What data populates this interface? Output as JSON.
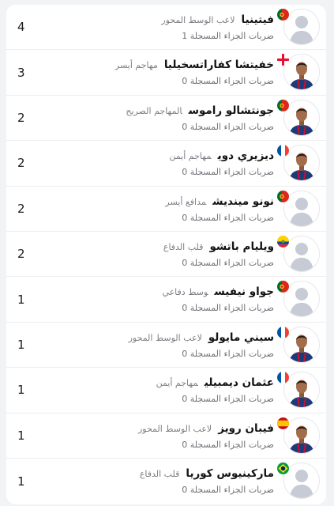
{
  "players": [
    {
      "name": "فيتينيا",
      "position": "لاعب الوسط المحور",
      "stat_label": "ضربات الجزاء المسجلة",
      "stat_value": "1",
      "count": "4",
      "flag": "portugal",
      "avatar": "placeholder"
    },
    {
      "name": "خفيتشا كفاراتسخيليا",
      "position": "مهاجم أيسر",
      "stat_label": "ضربات الجزاء المسجلة",
      "stat_value": "0",
      "count": "3",
      "flag": "georgia",
      "avatar": "photo"
    },
    {
      "name": "جونتشالو راموس",
      "position": "المهاجم الصريح",
      "stat_label": "ضربات الجزاء المسجلة",
      "stat_value": "0",
      "count": "2",
      "flag": "portugal",
      "avatar": "photo"
    },
    {
      "name": "ديزيري دوي",
      "position": "مهاجم أيمن",
      "stat_label": "ضربات الجزاء المسجلة",
      "stat_value": "0",
      "count": "2",
      "flag": "france",
      "avatar": "photo"
    },
    {
      "name": "نونو مينديش",
      "position": "مدافع أيسر",
      "stat_label": "ضربات الجزاء المسجلة",
      "stat_value": "0",
      "count": "2",
      "flag": "portugal",
      "avatar": "placeholder"
    },
    {
      "name": "ويليام باتشو",
      "position": "قلب الدفاع",
      "stat_label": "ضربات الجزاء المسجلة",
      "stat_value": "0",
      "count": "2",
      "flag": "ecuador",
      "avatar": "placeholder"
    },
    {
      "name": "جواو نيفيس",
      "position": "وسط دفاعي",
      "stat_label": "ضربات الجزاء المسجلة",
      "stat_value": "0",
      "count": "1",
      "flag": "portugal",
      "avatar": "placeholder"
    },
    {
      "name": "سيني مايولو",
      "position": "لاعب الوسط المحور",
      "stat_label": "ضربات الجزاء المسجلة",
      "stat_value": "0",
      "count": "1",
      "flag": "france",
      "avatar": "photo"
    },
    {
      "name": "عثمان ديمبيلي",
      "position": "مهاجم أيمن",
      "stat_label": "ضربات الجزاء المسجلة",
      "stat_value": "0",
      "count": "1",
      "flag": "france",
      "avatar": "photo"
    },
    {
      "name": "فيبان رويز",
      "position": "لاعب الوسط المحور",
      "stat_label": "ضربات الجزاء المسجلة",
      "stat_value": "0",
      "count": "1",
      "flag": "spain",
      "avatar": "photo"
    },
    {
      "name": "ماركينيوس كوريا",
      "position": "قلب الدفاع",
      "stat_label": "ضربات الجزاء المسجلة",
      "stat_value": "0",
      "count": "1",
      "flag": "brazil",
      "avatar": "placeholder"
    }
  ],
  "colors": {
    "accent": "#ffffff",
    "kit_blue": "#1c3b79",
    "kit_red": "#c8102e",
    "placeholder": "#c6cbd6"
  }
}
